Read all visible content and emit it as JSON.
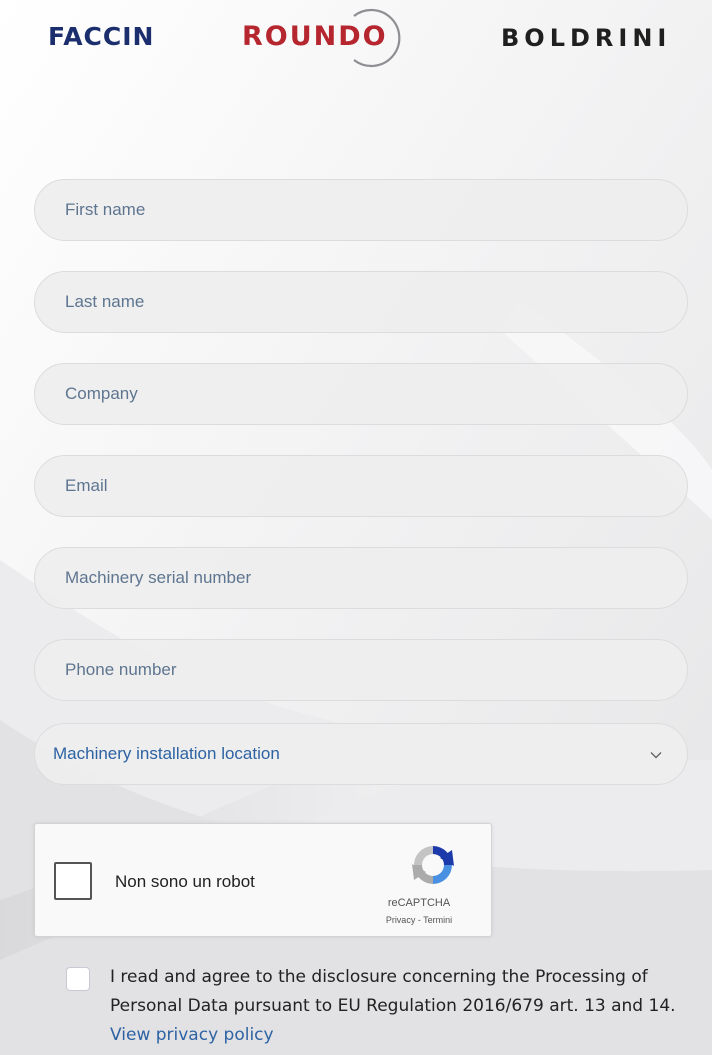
{
  "logos": {
    "faccin": "FACCIN",
    "roundo": "ROUNDO",
    "boldrini": "BOLDRINI"
  },
  "form": {
    "first_name": {
      "placeholder": "First name",
      "value": ""
    },
    "last_name": {
      "placeholder": "Last name",
      "value": ""
    },
    "company": {
      "placeholder": "Company",
      "value": ""
    },
    "email": {
      "placeholder": "Email",
      "value": ""
    },
    "serial": {
      "placeholder": "Machinery serial number",
      "value": ""
    },
    "phone": {
      "placeholder": "Phone number",
      "value": ""
    },
    "location": {
      "selected": "Machinery installation location",
      "icon": "chevron-down-icon"
    }
  },
  "recaptcha": {
    "label": "Non sono un robot",
    "brand": "reCAPTCHA",
    "links": "Privacy - Termini",
    "checked": false
  },
  "consent": {
    "text": "I read and agree to the disclosure concerning the Processing of Personal Data pursuant to EU Regulation 2016/679 art. 13 and 14.",
    "link_label": "View privacy policy",
    "checked": false
  },
  "colors": {
    "faccin": "#1b2f6e",
    "roundo": "#b5262f",
    "boldrini": "#1f1f1f",
    "placeholder": "#5e7590",
    "link": "#2d62a3"
  }
}
